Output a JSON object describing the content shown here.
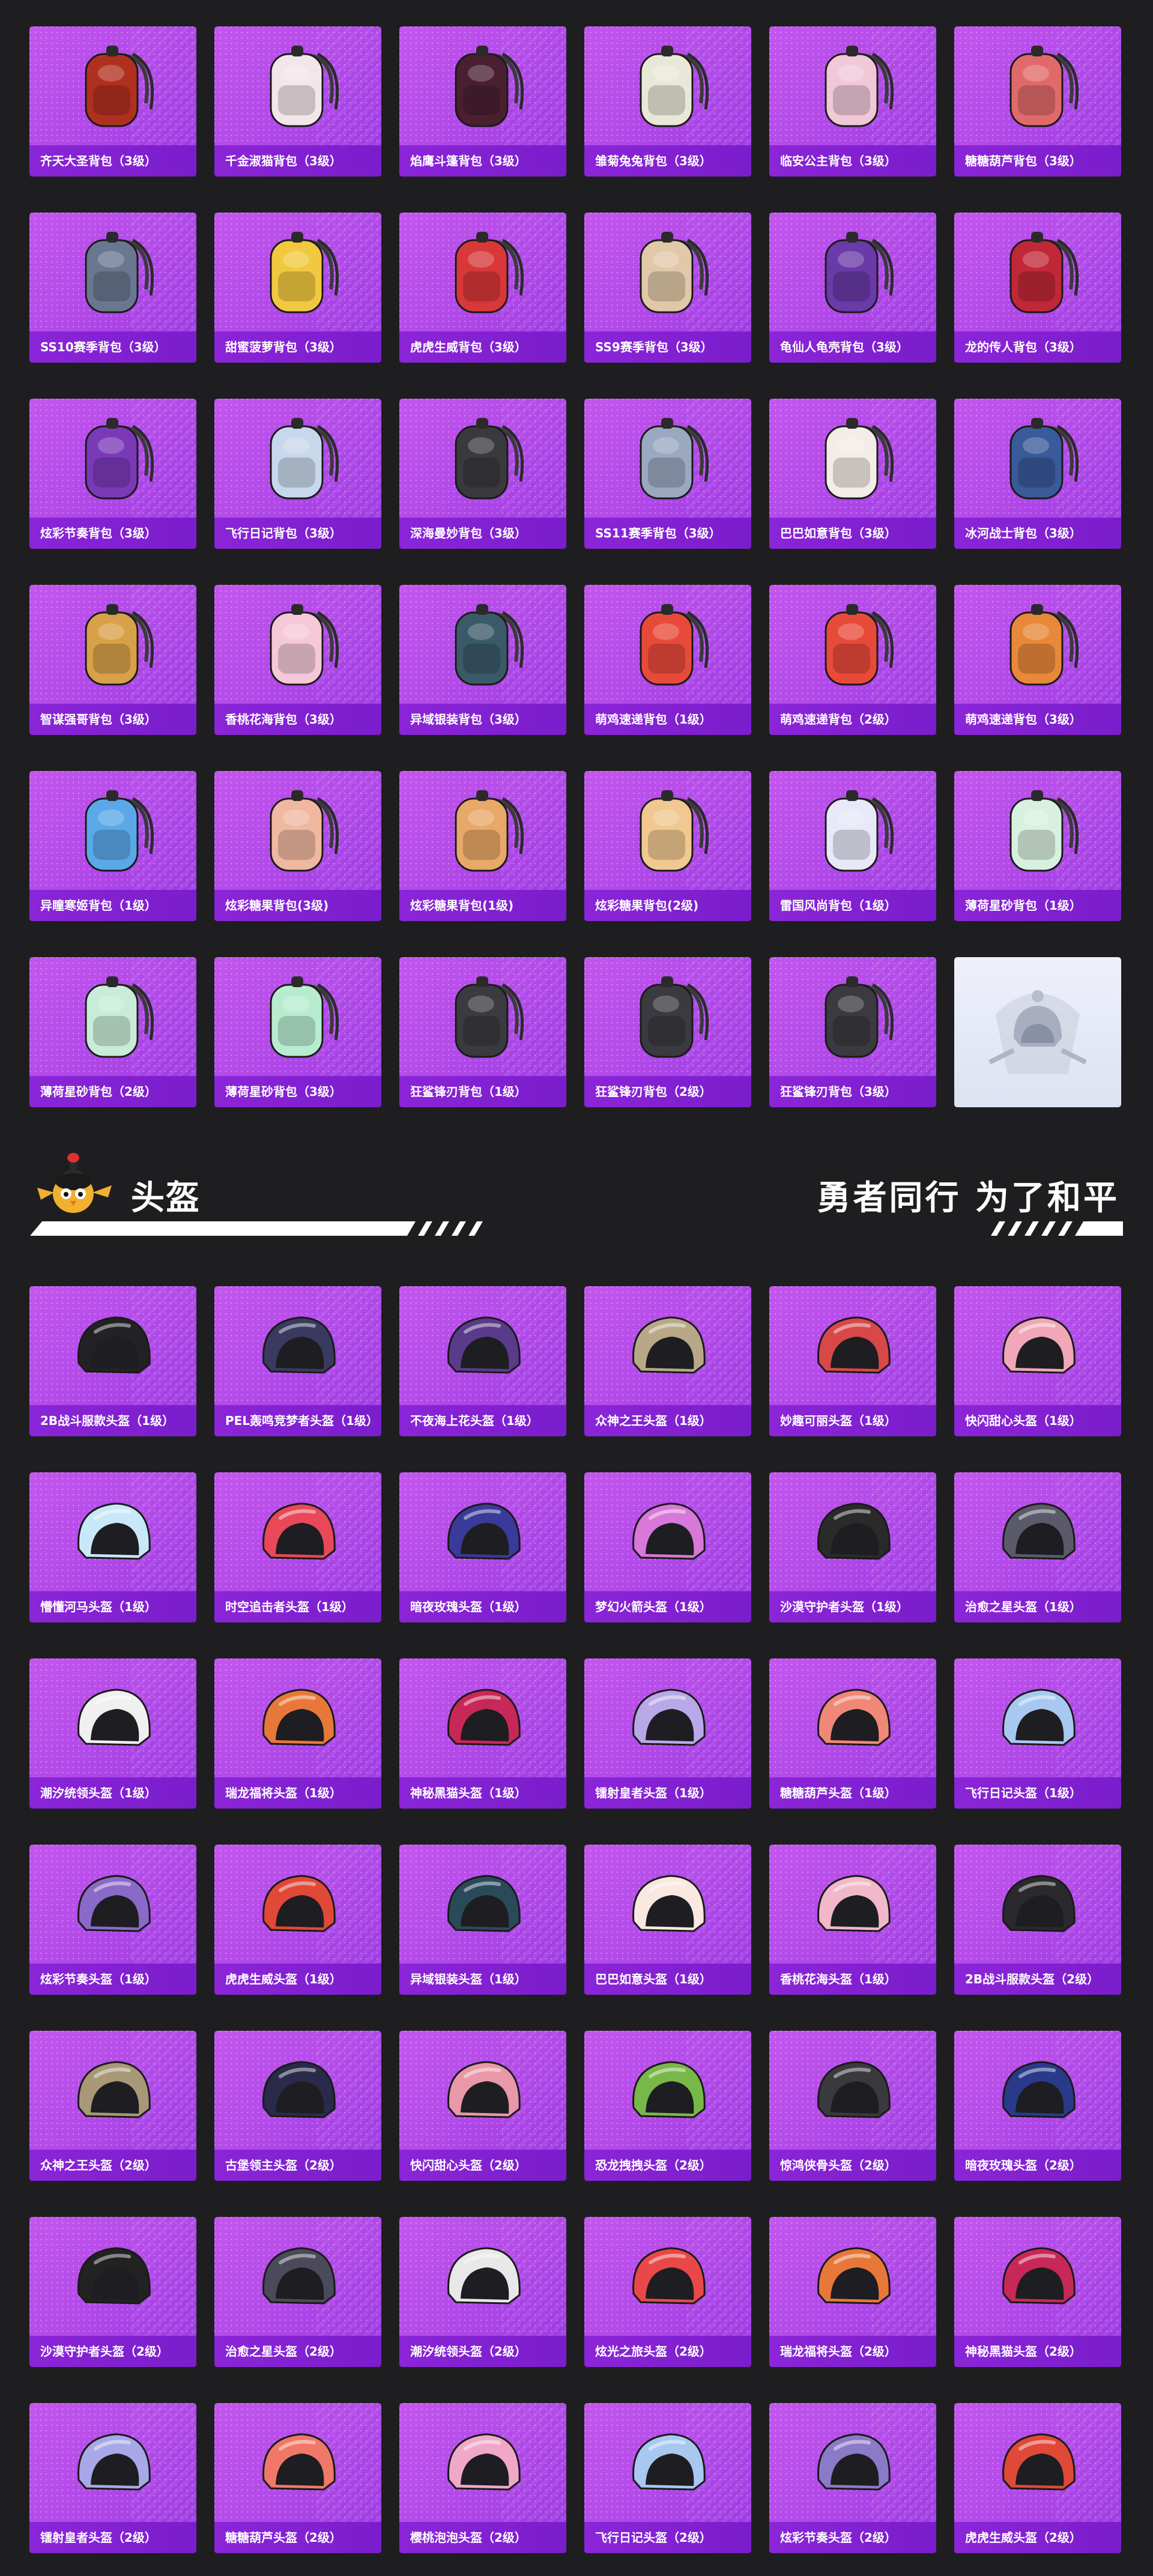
{
  "colors": {
    "background": "#1e1e20",
    "card_gradient_start": "#c456ee",
    "card_gradient_end": "#9a38e1",
    "label_bar": "#8b25d8",
    "emblem_card": "#e4e8f5"
  },
  "backpacks": [
    {
      "label": "齐天大圣背包（3级）",
      "icon": "backpack-icon",
      "color": "#b03020"
    },
    {
      "label": "千金淑猫背包（3级）",
      "icon": "backpack-icon",
      "color": "#f3e6ea"
    },
    {
      "label": "焰鹰斗篷背包（3级）",
      "icon": "backpack-icon",
      "color": "#4a2030"
    },
    {
      "label": "雏菊兔兔背包（3级）",
      "icon": "backpack-icon",
      "color": "#e8e8d8"
    },
    {
      "label": "临安公主背包（3级）",
      "icon": "backpack-icon",
      "color": "#f0c8d8"
    },
    {
      "label": "糖糖葫芦背包（3级）",
      "icon": "backpack-icon",
      "color": "#e06a6a"
    },
    {
      "label": "SS10赛季背包（3级）",
      "icon": "backpack-icon",
      "color": "#6a7790"
    },
    {
      "label": "甜蜜菠萝背包（3级）",
      "icon": "backpack-icon",
      "color": "#f2c840"
    },
    {
      "label": "虎虎生威背包（3级）",
      "icon": "backpack-icon",
      "color": "#d83838"
    },
    {
      "label": "SS9赛季背包（3级）",
      "icon": "backpack-icon",
      "color": "#e0c8a8"
    },
    {
      "label": "龟仙人龟壳背包（3级）",
      "icon": "backpack-icon",
      "color": "#6a3aa8"
    },
    {
      "label": "龙的传人背包（3级）",
      "icon": "backpack-icon",
      "color": "#c02838"
    },
    {
      "label": "炫彩节奏背包（3级）",
      "icon": "backpack-icon",
      "color": "#7a3ab8"
    },
    {
      "label": "飞行日记背包（3级）",
      "icon": "backpack-icon",
      "color": "#c8d8ec"
    },
    {
      "label": "深海曼妙背包（3级）",
      "icon": "backpack-icon",
      "color": "#3a3a3e"
    },
    {
      "label": "SS11赛季背包（3级）",
      "icon": "backpack-icon",
      "color": "#9aa8c0"
    },
    {
      "label": "巴巴如意背包（3级）",
      "icon": "backpack-icon",
      "color": "#f4ece6"
    },
    {
      "label": "冰河战士背包（3级）",
      "icon": "backpack-icon",
      "color": "#3a5a9a"
    },
    {
      "label": "智谋强哥背包（3级）",
      "icon": "backpack-icon",
      "color": "#d8a048"
    },
    {
      "label": "香桃花海背包（3级）",
      "icon": "backpack-icon",
      "color": "#f4c8d8"
    },
    {
      "label": "异域银装背包（3级）",
      "icon": "backpack-icon",
      "color": "#3a5a6a"
    },
    {
      "label": "萌鸡速递背包（1级）",
      "icon": "backpack-icon",
      "color": "#e84a3a"
    },
    {
      "label": "萌鸡速递背包（2级）",
      "icon": "backpack-icon",
      "color": "#e84a3a"
    },
    {
      "label": "萌鸡速递背包（3级）",
      "icon": "backpack-icon",
      "color": "#e8883a"
    },
    {
      "label": "异瞳寒姬背包（1级）",
      "icon": "backpack-icon",
      "color": "#5aa8e8"
    },
    {
      "label": "炫彩糖果背包(3级)",
      "icon": "backpack-icon",
      "color": "#f0b8a0"
    },
    {
      "label": "炫彩糖果背包(1级)",
      "icon": "backpack-icon",
      "color": "#e8a868"
    },
    {
      "label": "炫彩糖果背包(2级)",
      "icon": "backpack-icon",
      "color": "#f0c890"
    },
    {
      "label": "雷国风尚背包（1级）",
      "icon": "backpack-icon",
      "color": "#e8e8f8"
    },
    {
      "label": "薄荷星砂背包（1级）",
      "icon": "backpack-icon",
      "color": "#d8f0e0"
    },
    {
      "label": "薄荷星砂背包（2级）",
      "icon": "backpack-icon",
      "color": "#c8ecd8"
    },
    {
      "label": "薄荷星砂背包（3级）",
      "icon": "backpack-icon",
      "color": "#b8ecd0"
    },
    {
      "label": "狂鲨锋刃背包（1级）",
      "icon": "backpack-icon",
      "color": "#3a3a40"
    },
    {
      "label": "狂鲨锋刃背包（2级）",
      "icon": "backpack-icon",
      "color": "#3a3a40"
    },
    {
      "label": "狂鲨锋刃背包（3级）",
      "icon": "backpack-icon",
      "color": "#3a3a40"
    }
  ],
  "emblem": {
    "icon": "helmet-emblem-icon"
  },
  "section": {
    "title": "头盔",
    "slogan": "勇者同行 为了和平",
    "mascot_icon": "chick-mascot-icon"
  },
  "helmets": [
    {
      "label": "2B战斗服款头盔（1级）",
      "icon": "helmet-icon",
      "color": "#222226"
    },
    {
      "label": "PEL轰鸣竞梦者头盔（1级）",
      "icon": "helmet-icon",
      "color": "#3a3a60"
    },
    {
      "label": "不夜海上花头盔（1级）",
      "icon": "helmet-icon",
      "color": "#5a3a8a"
    },
    {
      "label": "众神之王头盔（1级）",
      "icon": "helmet-icon",
      "color": "#b8a888"
    },
    {
      "label": "妙趣可丽头盔（1级）",
      "icon": "helmet-icon",
      "color": "#d84848"
    },
    {
      "label": "快闪甜心头盔（1级）",
      "icon": "helmet-icon",
      "color": "#f0a8b8"
    },
    {
      "label": "懵懂河马头盔（1级）",
      "icon": "helmet-icon",
      "color": "#c8e8f8"
    },
    {
      "label": "时空追击者头盔（1级）",
      "icon": "helmet-icon",
      "color": "#e84858"
    },
    {
      "label": "暗夜玫瑰头盔（1级）",
      "icon": "helmet-icon",
      "color": "#3a3a9a"
    },
    {
      "label": "梦幻火箭头盔（1级）",
      "icon": "helmet-icon",
      "color": "#d878d8"
    },
    {
      "label": "沙漠守护者头盔（1级）",
      "icon": "helmet-icon",
      "color": "#2a2a2a"
    },
    {
      "label": "治愈之星头盔（1级）",
      "icon": "helmet-icon",
      "color": "#5a5a6a"
    },
    {
      "label": "潮汐统领头盔（1级）",
      "icon": "helmet-icon",
      "color": "#f0f0f0"
    },
    {
      "label": "瑞龙福将头盔（1级）",
      "icon": "helmet-icon",
      "color": "#e8783a"
    },
    {
      "label": "神秘黑猫头盔（1级）",
      "icon": "helmet-icon",
      "color": "#c82858"
    },
    {
      "label": "镭射皇者头盔（1级）",
      "icon": "helmet-icon",
      "color": "#b8a8e8"
    },
    {
      "label": "糖糖葫芦头盔（1级）",
      "icon": "helmet-icon",
      "color": "#f08878"
    },
    {
      "label": "飞行日记头盔（1级）",
      "icon": "helmet-icon",
      "color": "#a8c8f0"
    },
    {
      "label": "炫彩节奏头盔（1级）",
      "icon": "helmet-icon",
      "color": "#8a6ac8"
    },
    {
      "label": "虎虎生威头盔（1级）",
      "icon": "helmet-icon",
      "color": "#e04838"
    },
    {
      "label": "异域银装头盔（1级）",
      "icon": "helmet-icon",
      "color": "#2a4a5a"
    },
    {
      "label": "巴巴如意头盔（1级）",
      "icon": "helmet-icon",
      "color": "#f8e8e0"
    },
    {
      "label": "香桃花海头盔（1级）",
      "icon": "helmet-icon",
      "color": "#f0b8c8"
    },
    {
      "label": "2B战斗服款头盔（2级）",
      "icon": "helmet-icon",
      "color": "#2a2a2e"
    },
    {
      "label": "众神之王头盔（2级）",
      "icon": "helmet-icon",
      "color": "#a89878"
    },
    {
      "label": "古堡领主头盔（2级）",
      "icon": "helmet-icon",
      "color": "#2a2a4a"
    },
    {
      "label": "快闪甜心头盔（2级）",
      "icon": "helmet-icon",
      "color": "#e898a8"
    },
    {
      "label": "恐龙拽拽头盔（2级）",
      "icon": "helmet-icon",
      "color": "#78b848"
    },
    {
      "label": "惊鸿侠骨头盔（2级）",
      "icon": "helmet-icon",
      "color": "#3a3a3e"
    },
    {
      "label": "暗夜玫瑰头盔（2级）",
      "icon": "helmet-icon",
      "color": "#2a3a8a"
    },
    {
      "label": "沙漠守护者头盔（2级）",
      "icon": "helmet-icon",
      "color": "#222222"
    },
    {
      "label": "治愈之星头盔（2级）",
      "icon": "helmet-icon",
      "color": "#4a4a5a"
    },
    {
      "label": "潮汐统领头盔（2级）",
      "icon": "helmet-icon",
      "color": "#e8e8e8"
    },
    {
      "label": "炫光之旅头盔（2级）",
      "icon": "helmet-icon",
      "color": "#e84848"
    },
    {
      "label": "瑞龙福将头盔（2级）",
      "icon": "helmet-icon",
      "color": "#e8783a"
    },
    {
      "label": "神秘黑猫头盔（2级）",
      "icon": "helmet-icon",
      "color": "#c82858"
    },
    {
      "label": "镭射皇者头盔（2级）",
      "icon": "helmet-icon",
      "color": "#a8a8e8"
    },
    {
      "label": "糖糖葫芦头盔（2级）",
      "icon": "helmet-icon",
      "color": "#f07868"
    },
    {
      "label": "樱桃泡泡头盔（2级）",
      "icon": "helmet-icon",
      "color": "#f0a8c8"
    },
    {
      "label": "飞行日记头盔（2级）",
      "icon": "helmet-icon",
      "color": "#a8c8f0"
    },
    {
      "label": "炫彩节奏头盔（2级）",
      "icon": "helmet-icon",
      "color": "#8a7ac8"
    },
    {
      "label": "虎虎生威头盔（2级）",
      "icon": "helmet-icon",
      "color": "#e04838"
    }
  ]
}
